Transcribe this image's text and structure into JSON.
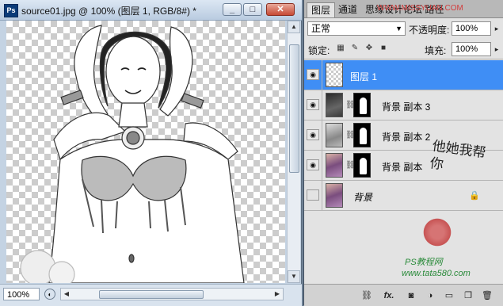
{
  "document": {
    "app_icon": "Ps",
    "title": "source01.jpg @ 100% (图层 1, RGB/8#) *",
    "controls": {
      "minimize": "_",
      "restore": "□",
      "close": "✕"
    },
    "zoom": "100%"
  },
  "panel": {
    "tabs": [
      "图层",
      "通道",
      "思缘设计论坛 路径"
    ],
    "watermark_top": "WWW.MISSYUAN.COM",
    "blend_mode": "正常",
    "opacity_label": "不透明度:",
    "opacity_value": "100%",
    "lock_label": "锁定:",
    "fill_label": "填充:",
    "fill_value": "100%",
    "layers": [
      {
        "name": "图层 1",
        "visible": true,
        "selected": true
      },
      {
        "name": "背景 副本 3",
        "visible": true,
        "selected": false
      },
      {
        "name": "背景 副本 2",
        "visible": true,
        "selected": false
      },
      {
        "name": "背景 副本",
        "visible": true,
        "selected": false
      },
      {
        "name": "背景",
        "visible": false,
        "selected": false,
        "locked": true
      }
    ],
    "watermark_calligraphy": "他她我帮你",
    "watermark_site": "PS教程网",
    "watermark_url": "www.tata580.com",
    "bottom_icons": [
      "link-icon",
      "fx-icon",
      "mask-icon",
      "adjustment-icon",
      "folder-icon",
      "new-layer-icon",
      "trash-icon"
    ],
    "selected_color": "#3f8ef5"
  }
}
